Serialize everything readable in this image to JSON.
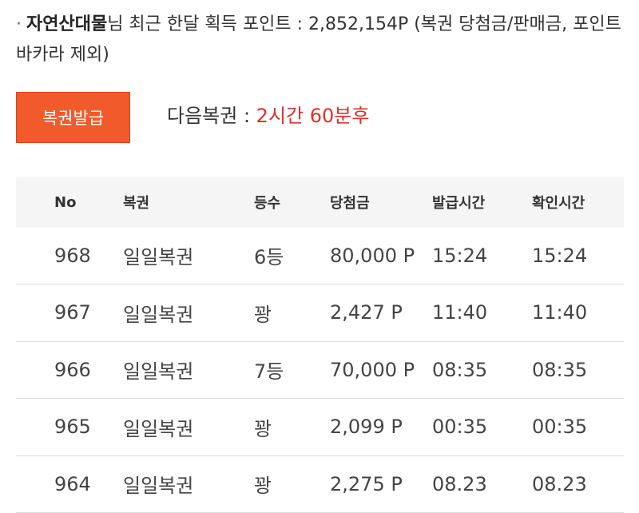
{
  "summary": {
    "bullet": "·",
    "username": "자연산대물",
    "text": "님 최근 한달 획득 포인트 : 2,852,154P (복권 당첨금/판매금, 포인트 바카라 제외)"
  },
  "issue_button": {
    "label": "복권발급"
  },
  "next_lottery": {
    "label": "다음복권 : ",
    "time": "2시간 60분후"
  },
  "colors": {
    "accent": "#f15a2b",
    "time_red": "#e0302a",
    "header_bg": "#f5f5f5"
  },
  "table": {
    "headers": [
      "No",
      "복권",
      "등수",
      "당첨금",
      "발급시간",
      "확인시간"
    ],
    "rows": [
      [
        "968",
        "일일복권",
        "6등",
        "80,000 P",
        "15:24",
        "15:24"
      ],
      [
        "967",
        "일일복권",
        "꽝",
        "2,427 P",
        "11:40",
        "11:40"
      ],
      [
        "966",
        "일일복권",
        "7등",
        "70,000 P",
        "08:35",
        "08:35"
      ],
      [
        "965",
        "일일복권",
        "꽝",
        "2,099 P",
        "00:35",
        "00:35"
      ],
      [
        "964",
        "일일복권",
        "꽝",
        "2,275 P",
        "08.23",
        "08.23"
      ]
    ]
  }
}
